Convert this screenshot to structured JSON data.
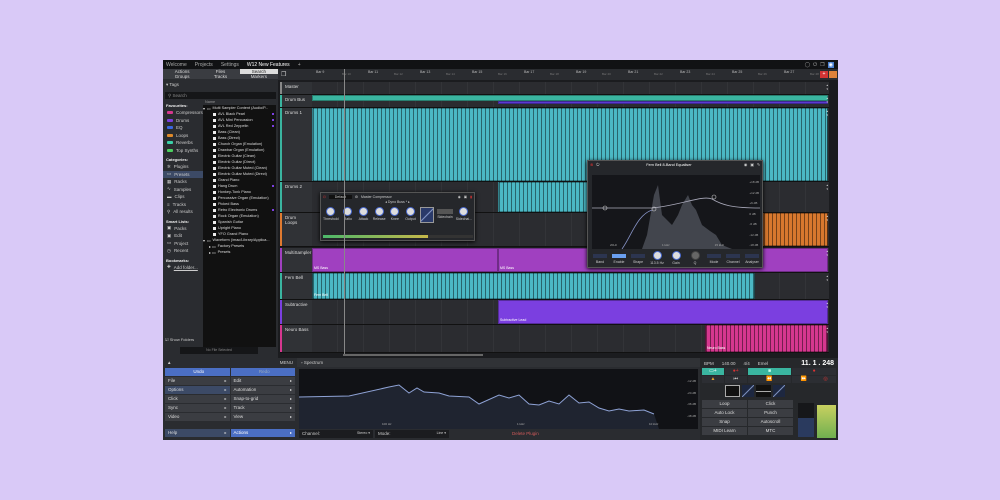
{
  "topbar": {
    "tabs": [
      "Welcome",
      "Projects",
      "Settings",
      "W12 New Features"
    ],
    "add": "+"
  },
  "left_tabs": [
    "Actions",
    "Files",
    "Search",
    "Groups",
    "Tracks",
    "Markers"
  ],
  "tags_header": "▾ Tags",
  "search_placeholder": "Search",
  "favourites": {
    "title": "Favourites:",
    "items": [
      {
        "label": "Compressors",
        "color": "#d6378f"
      },
      {
        "label": "Drums",
        "color": "#7b3fe0"
      },
      {
        "label": "EQ",
        "color": "#3a66e0"
      },
      {
        "label": "Loops",
        "color": "#e08a2a"
      },
      {
        "label": "Reverbs",
        "color": "#3ad0a8"
      },
      {
        "label": "Top Synths",
        "color": "#4cd060"
      }
    ]
  },
  "categories": {
    "title": "Categories:",
    "items": [
      "Plugins",
      "Presets",
      "Racks",
      "Samples",
      "Clips",
      "Tracks",
      "All results"
    ]
  },
  "smart_lists": {
    "title": "Smart Lists:",
    "items": [
      "Packs",
      "Edit",
      "Project",
      "Recent"
    ]
  },
  "bookmarks": {
    "title": "Bookmarks:",
    "add": "Add folder..."
  },
  "show_folders": "Show Folders",
  "no_file": "No File Selected",
  "browser": {
    "header": "Name",
    "root": "Multi Sampler Content (Audio/P...",
    "items": [
      "AVL Black Pearl",
      "AVL Mini Percussion",
      "AVL Red Zeppelin",
      "Bass (Clean)",
      "Bass (Direct)",
      "Church Organ (Emulation)",
      "Drawbar Organ (Emulation)",
      "Electric Guitar (Clean)",
      "Electric Guitar (Direct)",
      "Electric Guitar Muted (Clean)",
      "Electric Guitar Muted (Direct)",
      "Grand Piano",
      "Hang Drum",
      "Honkey-Tonk Piano",
      "Percussive Organ (Emulation)",
      "Picked Bass",
      "Retro Electronic Drums",
      "Rock Organ (Emulation)",
      "Spanish Guitar",
      "Upright Piano",
      "YFO Grand Piano"
    ],
    "root2": "Waveform (/mac/Library/Applica...",
    "sub": [
      "Factory Presets",
      "Presets"
    ]
  },
  "ruler": [
    "Bar 9",
    "Bar 10",
    "Bar 11",
    "Bar 12",
    "Bar 13",
    "Bar 14",
    "Bar 15",
    "Bar 16",
    "Bar 17",
    "Bar 18",
    "Bar 19",
    "Bar 20",
    "Bar 21",
    "Bar 22",
    "Bar 23",
    "Bar 24",
    "Bar 25",
    "Bar 26",
    "Bar 27",
    "Bar 28"
  ],
  "tracks": [
    {
      "name": "Master"
    },
    {
      "name": "Drum Bus"
    },
    {
      "name": "Drums 1"
    },
    {
      "name": "Drums 2"
    },
    {
      "name": "Drum Loops"
    },
    {
      "name": "MultiSampler"
    },
    {
      "name": "Fern Bell"
    },
    {
      "name": "Subtractive"
    },
    {
      "name": "Neuro Bass"
    }
  ],
  "clips": {
    "ms1": "MS Bass",
    "ms2": "MS Bass",
    "fern": "Fern Bell",
    "sub": "Subtractive Lead",
    "neuro": "Neuro Bass"
  },
  "compressor": {
    "preset": "Default",
    "title": "Master Compressor",
    "program": "Dyno Buss *",
    "knobs": [
      "Threshold",
      "Ratio",
      "Attack",
      "Release",
      "Knee",
      "Output"
    ],
    "sidechain": [
      "Sidechain",
      "Sidechai..."
    ]
  },
  "eq": {
    "title": "Fern Bell 8-Band Equaliser",
    "params": [
      "Band",
      "Enable",
      "Shape",
      "113.5 Hz",
      "Gain",
      "Q",
      "Mode",
      "Channel",
      "Analyser"
    ],
    "freq_labels": [
      "20Hz",
      "1 kHz",
      "15 kHz"
    ],
    "db_labels": [
      "+18 dB",
      "+12 dB",
      "+6 dB",
      "0 dB",
      "-6 dB",
      "-12 dB",
      "-18 dB"
    ]
  },
  "menu": {
    "title": "MENU",
    "undo": "Undo",
    "redo": "Redo",
    "left": [
      "File",
      "Options",
      "Click",
      "Sync",
      "Video"
    ],
    "right": [
      "Edit",
      "Automation",
      "Snap-to-grid",
      "Track",
      "View"
    ],
    "help": "Help",
    "actions": "Actions"
  },
  "spectrum": {
    "title": "Spectrum",
    "channel_label": "Channel:",
    "channel": "Stereo ▾",
    "mode_label": "Mode:",
    "mode": "Line ▾",
    "delete": "Delete Plugin",
    "freq": [
      "100 Hz",
      "1 kHz",
      "10 kHz"
    ],
    "db": [
      "-12 dB",
      "-24 dB",
      "-36 dB",
      "-48 dB"
    ]
  },
  "transport": {
    "bpm_label": "BPM",
    "bpm": "140.00",
    "sig": "4/4",
    "key": "Emel",
    "position": "11. 1 . 248",
    "buttons": [
      "Loop",
      "Click",
      "Auto Lock",
      "Punch",
      "Snap",
      "Autoscroll",
      "MIDI Learn",
      "MTC"
    ]
  }
}
